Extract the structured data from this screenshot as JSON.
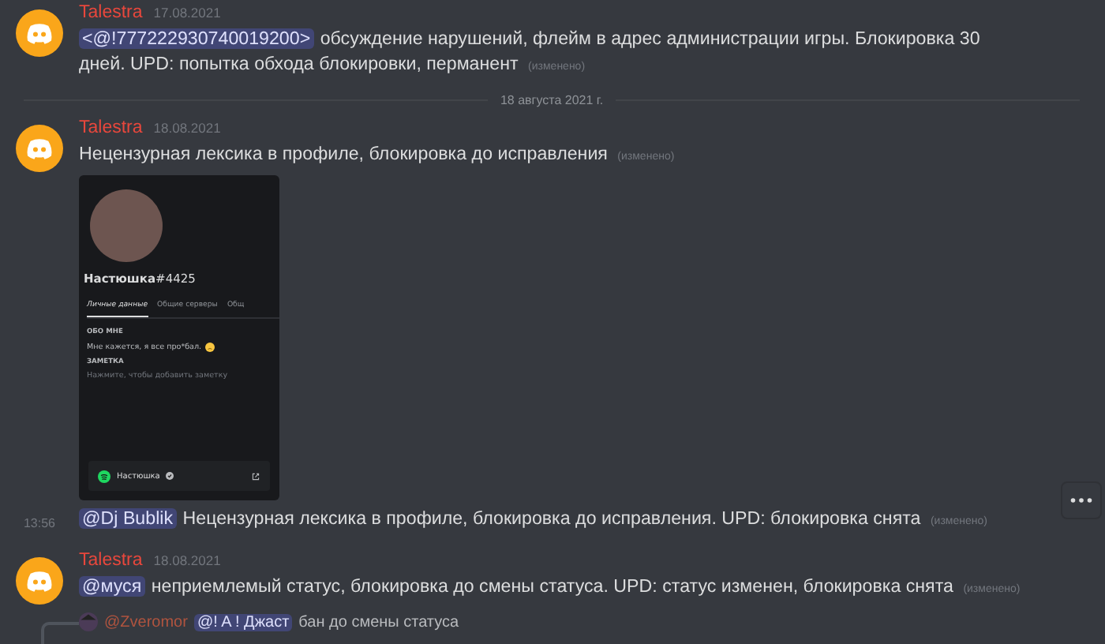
{
  "messages": [
    {
      "kind": "group",
      "author": "Talestra",
      "timestamp": "17.08.2021",
      "content": {
        "mention": "<@!777222930740019200>",
        "text": "обсуждение нарушений, флейм в адрес администрации игры. Блокировка 30 дней. UPD: попытка обхода блокировки, перманент",
        "edited": "(изменено)"
      }
    },
    {
      "kind": "divider",
      "label": "18 августа 2021 г."
    },
    {
      "kind": "group",
      "author": "Talestra",
      "timestamp": "18.08.2021",
      "content": {
        "text": "Нецензурная лексика в профиле, блокировка до исправления",
        "edited": "(изменено)"
      },
      "attachment": {
        "name": "**Настюшка**#4425",
        "tabs": [
          {
            "label": "Личные данные",
            "selected": true
          },
          {
            "label": "Общие серверы",
            "selected": false
          },
          {
            "label": "Общ",
            "selected": false
          }
        ],
        "about_heading": "ОБО МНЕ",
        "about": "Мне кажется, я все про*бал.",
        "note_heading": "ЗАМЕТКА",
        "note_placeholder": "Нажмите, чтобы добавить заметку",
        "activity": "Настюшка"
      }
    },
    {
      "kind": "followup",
      "time": "13:56",
      "hovered": true,
      "content": {
        "mention": "@Dj Bublik",
        "text": "Нецензурная лексика в профиле, блокировка до исправления.  UPD: блокировка снята",
        "edited": "(изменено)"
      }
    },
    {
      "kind": "group",
      "author": "Talestra",
      "timestamp": "18.08.2021",
      "content": {
        "mention": "@муся",
        "text": "неприемлемый статус, блокировка до смены статуса. UPD: статус изменен, блокировка снята",
        "edited": "(изменено)"
      }
    },
    {
      "kind": "reply",
      "author": "@Zveromor",
      "mention": "@! A ! Джаст",
      "text": "бан до смены статуса"
    }
  ]
}
